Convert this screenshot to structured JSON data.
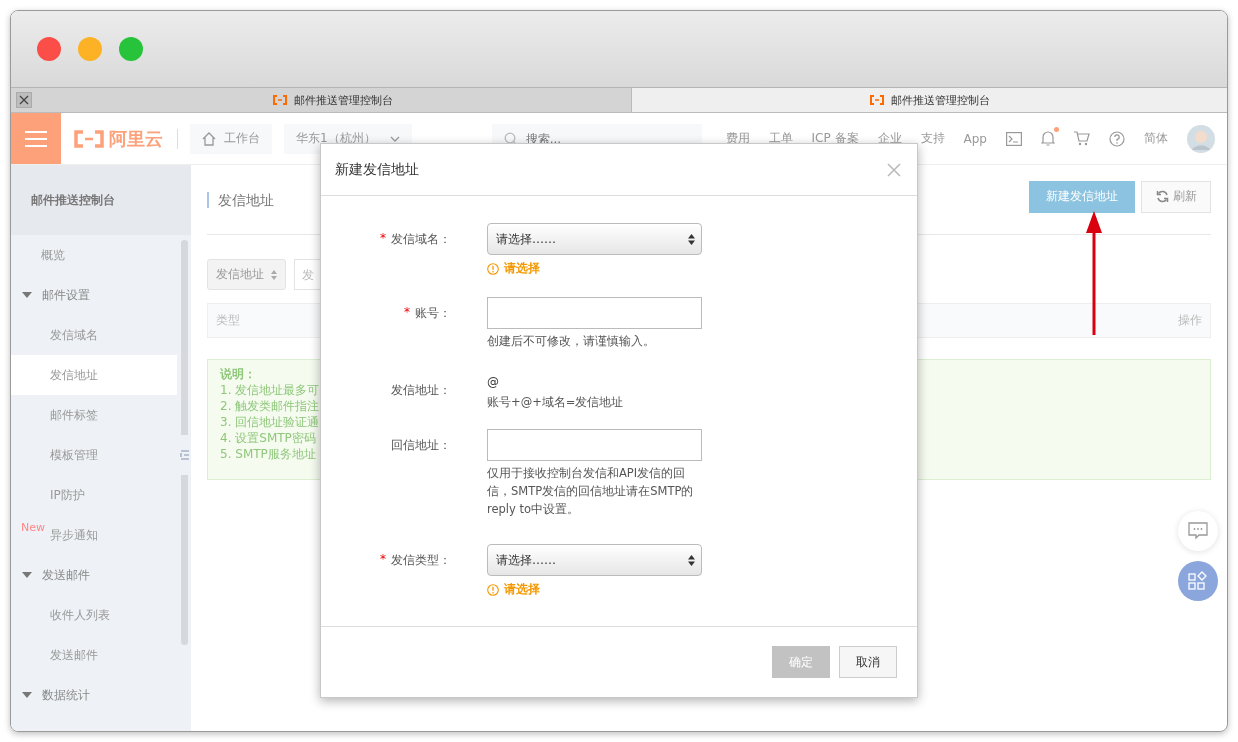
{
  "browser_tabs": [
    {
      "label": "邮件推送管理控制台",
      "selected": false
    },
    {
      "label": "邮件推送管理控制台",
      "selected": true
    }
  ],
  "top_nav": {
    "logo": "阿里云",
    "workbench": "工作台",
    "region": "华东1（杭州）",
    "search": {
      "placeholder": "搜索..."
    },
    "links": [
      "费用",
      "工单",
      "ICP 备案",
      "企业",
      "支持",
      "App"
    ],
    "bell_unread": true,
    "language": "简体"
  },
  "sidebar": {
    "title": "邮件推送控制台",
    "items": [
      {
        "label": "概览",
        "kind": "item",
        "selected": false
      },
      {
        "label": "邮件设置",
        "kind": "group",
        "expanded": true,
        "children": [
          {
            "label": "发信域名",
            "selected": false
          },
          {
            "label": "发信地址",
            "selected": true
          },
          {
            "label": "邮件标签",
            "selected": false
          },
          {
            "label": "模板管理",
            "selected": false
          },
          {
            "label": "IP防护",
            "selected": false
          },
          {
            "label": "异步通知",
            "selected": false,
            "badge": "New"
          }
        ]
      },
      {
        "label": "发送邮件",
        "kind": "group",
        "expanded": true,
        "children": [
          {
            "label": "收件人列表",
            "selected": false
          },
          {
            "label": "发送邮件",
            "selected": false
          }
        ]
      },
      {
        "label": "数据统计",
        "kind": "group",
        "expanded": true
      }
    ]
  },
  "page": {
    "title": "发信地址",
    "buttons": [
      {
        "label": "新建发信地址",
        "kind": "primary"
      },
      {
        "label": "刷新",
        "kind": "refresh"
      }
    ],
    "filter": {
      "select": "发信地址",
      "input_placeholder": "发"
    },
    "table": {
      "columns": [
        "类型",
        "操作"
      ]
    },
    "notice": {
      "title": "说明：",
      "lines": [
        "1. 发信地址最多可",
        "2. 触发类邮件指注",
        "3. 回信地址验证通",
        "4. 设置SMTP密码",
        "5. SMTP服务地址"
      ]
    }
  },
  "dialog": {
    "title": "新建发信地址",
    "fields": [
      {
        "label": "发信域名：",
        "required_mark": "*",
        "kind": "select",
        "value": "请选择……",
        "error": "请选择"
      },
      {
        "label": "账号：",
        "required_mark": "*",
        "kind": "input",
        "help": "创建后不可修改，请谨慎输入。"
      },
      {
        "label": "发信地址：",
        "kind": "text",
        "value": "@",
        "help": "账号+@+域名=发信地址"
      },
      {
        "label": "回信地址：",
        "kind": "input",
        "help": "仅用于接收控制台发信和API发信的回信，SMTP发信的回信地址请在SMTP的reply to中设置。"
      },
      {
        "label": "发信类型：",
        "required_mark": "*",
        "kind": "select",
        "value": "请选择……",
        "error": "请选择"
      }
    ],
    "buttons": [
      {
        "label": "确定",
        "disabled": true
      },
      {
        "label": "取消",
        "disabled": false
      }
    ]
  }
}
